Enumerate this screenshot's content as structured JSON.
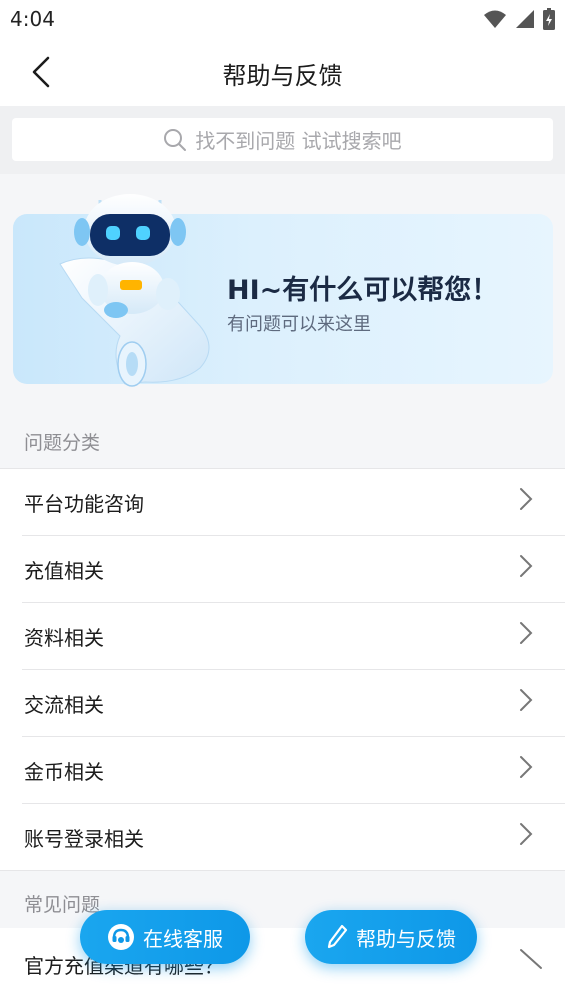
{
  "status_bar": {
    "time": "4:04"
  },
  "header": {
    "title": "帮助与反馈"
  },
  "search": {
    "placeholder": "找不到问题 试试搜索吧"
  },
  "banner": {
    "title": "HI~有什么可以帮您！",
    "subtitle": "有问题可以来这里"
  },
  "categories": {
    "section_title": "问题分类",
    "items": [
      {
        "label": "平台功能咨询"
      },
      {
        "label": "充值相关"
      },
      {
        "label": "资料相关"
      },
      {
        "label": "交流相关"
      },
      {
        "label": "金币相关"
      },
      {
        "label": "账号登录相关"
      }
    ]
  },
  "faq": {
    "section_title": "常见问题",
    "items": [
      {
        "label": "官方充值渠道有哪些？"
      }
    ]
  },
  "fab": {
    "service_label": "在线客服",
    "feedback_label": "帮助与反馈"
  },
  "colors": {
    "accent": "#0e98e8",
    "banner_bg": "#dcf0fd"
  }
}
